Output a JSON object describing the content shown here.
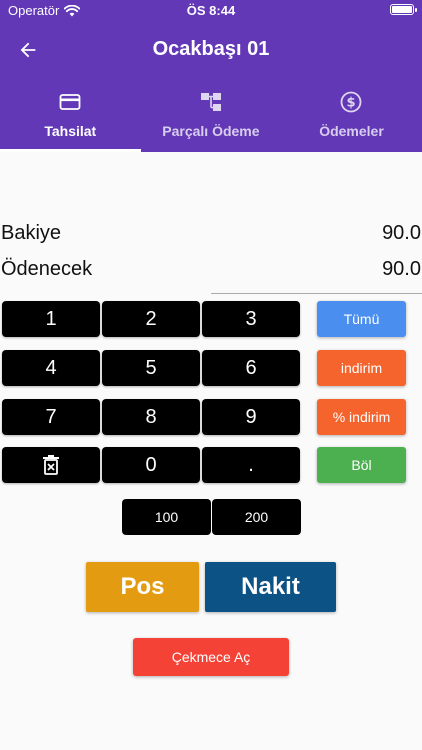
{
  "status_bar": {
    "carrier": "Operatör",
    "time": "ÖS 8:44"
  },
  "app_bar": {
    "title": "Ocakbaşı 01",
    "back_icon": "arrow-back-icon"
  },
  "tabs": [
    {
      "label": "Tahsilat",
      "icon": "credit-card-icon",
      "active": true
    },
    {
      "label": "Parçalı Ödeme",
      "icon": "split-icon",
      "active": false
    },
    {
      "label": "Ödemeler",
      "icon": "dollar-circle-icon",
      "active": false
    }
  ],
  "summary": {
    "balance_label": "Bakiye",
    "balance_value": "90.0",
    "payable_label": "Ödenecek",
    "payable_value": "90.0"
  },
  "keypad": {
    "k1": "1",
    "k2": "2",
    "k3": "3",
    "k4": "4",
    "k5": "5",
    "k6": "6",
    "k7": "7",
    "k8": "8",
    "k9": "9",
    "clear_icon": "delete-icon",
    "k0": "0",
    "dot": "."
  },
  "side_buttons": {
    "all": "Tümü",
    "discount": "indirim",
    "percent_discount": "% indirim",
    "split": "Böl"
  },
  "quick_amounts": {
    "a100": "100",
    "a200": "200"
  },
  "payment": {
    "pos": "Pos",
    "cash": "Nakit"
  },
  "drawer_label": "Çekmece Aç",
  "colors": {
    "header": "#6238b7",
    "all": "#4a8ff0",
    "discount": "#f4642c",
    "split": "#4caf50",
    "pos": "#e39b12",
    "cash": "#0c5285",
    "drawer": "#f44336"
  }
}
